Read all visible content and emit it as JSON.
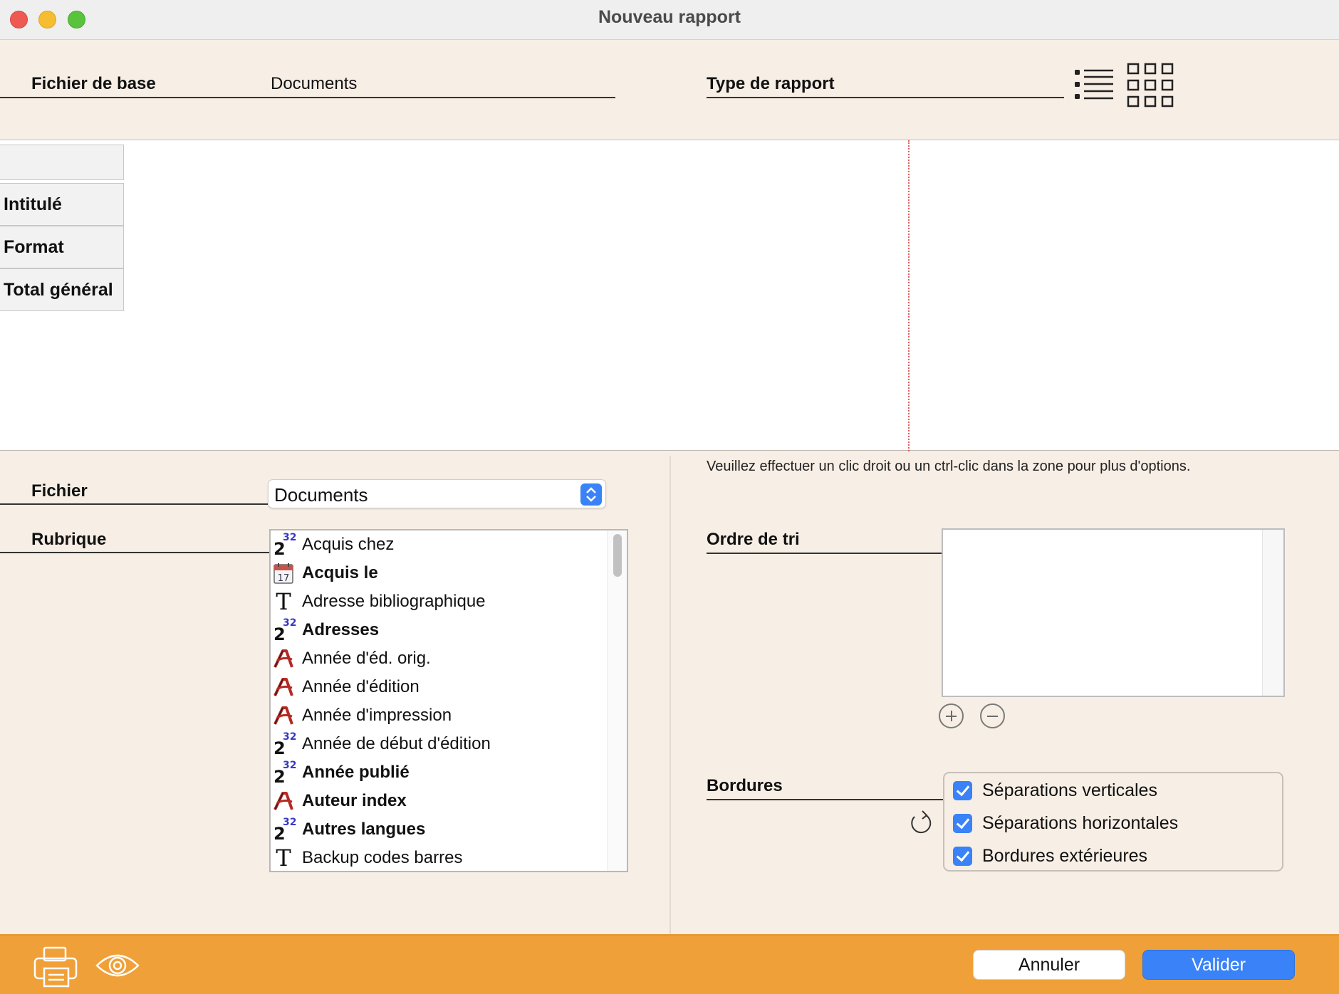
{
  "window": {
    "title": "Nouveau rapport"
  },
  "header": {
    "base_file_label": "Fichier de base",
    "base_file_value": "Documents",
    "report_type_label": "Type de rapport",
    "report_type_icons": [
      "list-layout-icon",
      "grid-layout-icon"
    ]
  },
  "preview": {
    "row_headers": [
      "Intitulé",
      "Format",
      "Total général"
    ]
  },
  "hint": "Veuillez effectuer un clic droit ou un ctrl-clic dans la zone pour plus d'options.",
  "file": {
    "label": "Fichier",
    "selected": "Documents"
  },
  "fields": {
    "label": "Rubrique",
    "items": [
      {
        "label": "Acquis chez",
        "icon": "number-icon",
        "bold": false
      },
      {
        "label": "Acquis le",
        "icon": "calendar-icon",
        "bold": true
      },
      {
        "label": "Adresse bibliographique",
        "icon": "text-icon",
        "bold": false
      },
      {
        "label": "Adresses",
        "icon": "number-icon",
        "bold": true
      },
      {
        "label": "Année d'éd. orig.",
        "icon": "alpha-icon",
        "bold": false
      },
      {
        "label": "Année d'édition",
        "icon": "alpha-icon",
        "bold": false
      },
      {
        "label": "Année d'impression",
        "icon": "alpha-icon",
        "bold": false
      },
      {
        "label": "Année de début d'édition",
        "icon": "number-icon",
        "bold": false
      },
      {
        "label": "Année publié",
        "icon": "number-icon",
        "bold": true
      },
      {
        "label": "Auteur index",
        "icon": "alpha-icon",
        "bold": true
      },
      {
        "label": "Autres langues",
        "icon": "number-icon",
        "bold": true
      },
      {
        "label": "Backup codes barres",
        "icon": "text-icon",
        "bold": false
      }
    ],
    "number_icon_base": "2",
    "number_icon_sup": "32",
    "calendar_day": "17",
    "text_icon_glyph": "T"
  },
  "sort": {
    "label": "Ordre de tri"
  },
  "borders": {
    "label": "Bordures",
    "options": [
      {
        "label": "Séparations verticales",
        "checked": true
      },
      {
        "label": "Séparations horizontales",
        "checked": true
      },
      {
        "label": "Bordures extérieures",
        "checked": true
      }
    ]
  },
  "footer": {
    "cancel_label": "Annuler",
    "ok_label": "Valider"
  },
  "colors": {
    "background": "#f7eee5",
    "footer": "#f0a038",
    "accent": "#3a82f7"
  }
}
